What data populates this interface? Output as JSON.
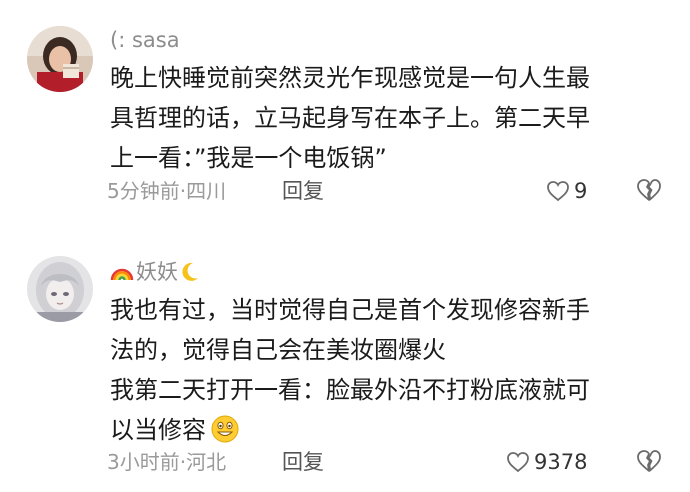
{
  "comments": [
    {
      "username": "(: sasa",
      "lines": [
        "晚上快睡觉前突然灵光乍现感觉是一句人生最",
        "具哲理的话，立马起身写在本子上。第二天早",
        "上一看：”我是一个电饭锅”"
      ],
      "meta": "5分钟前·四川",
      "reply_label": "回复",
      "likes": "9",
      "avatar_icon": "woman-photo-avatar"
    },
    {
      "username": "妖妖",
      "username_prefix_icon": "rainbow-emoji",
      "username_suffix_icon": "crescent-moon-emoji",
      "lines": [
        "我也有过，当时觉得自己是首个发现修容新手",
        "法的，觉得自己会在美妆圈爆火",
        "我第二天打开一看：脸最外沿不打粉底液就可",
        "以当修容"
      ],
      "trailing_icon": "grinning-emoji",
      "meta": "3小时前·河北",
      "reply_label": "回复",
      "likes": "9378",
      "avatar_icon": "anime-girl-avatar"
    }
  ],
  "colors": {
    "meta_text": "#9a9a9a",
    "body_text": "#1b1b1b",
    "username_text": "#8c8c8c"
  }
}
